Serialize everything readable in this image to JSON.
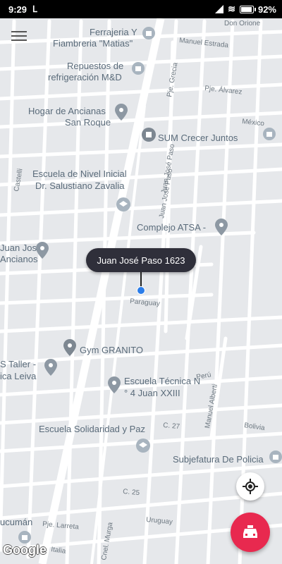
{
  "status_bar": {
    "time": "9:29",
    "battery": "92%"
  },
  "menu": {
    "icon": "hamburger-menu-icon"
  },
  "map": {
    "pois": [
      {
        "label1": "Ferrajeria Y",
        "label2": "Fiambreria \"Matias\"",
        "icon": "shopping-bag-icon"
      },
      {
        "label1": "Repuestos de",
        "label2": "refrigeración M&D",
        "icon": "shopping-bag-icon"
      },
      {
        "label1": "Hogar de Ancianas",
        "label2": "San Roque",
        "icon": "map-pin-icon"
      },
      {
        "label1": "SUM Crecer Juntos",
        "label2": "",
        "icon": "building-icon"
      },
      {
        "label1": "Escuela de Nivel Inicial",
        "label2": "Dr. Salustiano Zavalia",
        "icon": "school-icon"
      },
      {
        "label1": "Complejo ATSA -",
        "label2": "",
        "icon": "map-pin-icon"
      },
      {
        "label1": "Juan Jose",
        "label2": "Ancianos",
        "icon": "map-pin-icon"
      },
      {
        "label1": "Gym GRANITO",
        "label2": "",
        "icon": "map-pin-icon"
      },
      {
        "label1": "S Taller -",
        "label2": "ica Leiva",
        "icon": "map-pin-icon"
      },
      {
        "label1": "Escuela Técnica N",
        "label2": "° 4 Juan XXIII",
        "icon": "map-pin-icon"
      },
      {
        "label1": "Escuela Solidaridad y Paz",
        "label2": "",
        "icon": "school-icon"
      },
      {
        "label1": "Subjefatura De Policia",
        "label2": "",
        "icon": "shopping-bag-icon"
      },
      {
        "label1": "ucumán",
        "label2": "",
        "icon": "shopping-bag-icon"
      }
    ],
    "streets": [
      "Don Orione",
      "Manuel Estrada",
      "Pje. Grecia",
      "Pje. Álvarez",
      "México",
      "Castelli",
      "Juan José Paso",
      "Juan José Paso",
      "Paraguay",
      "Perú",
      "Manuel Alberti",
      "C. 27",
      "Bolivia",
      "C. 25",
      "Pje. Larreta",
      "Cnel. Murga",
      "Uruguay",
      "Italia"
    ]
  },
  "selected_location": {
    "label": "Juan José Paso 1623"
  },
  "locate_button": {
    "icon": "my-location-icon"
  },
  "taxi_button": {
    "icon": "taxi-icon"
  },
  "attribution": {
    "logo": "Google"
  }
}
